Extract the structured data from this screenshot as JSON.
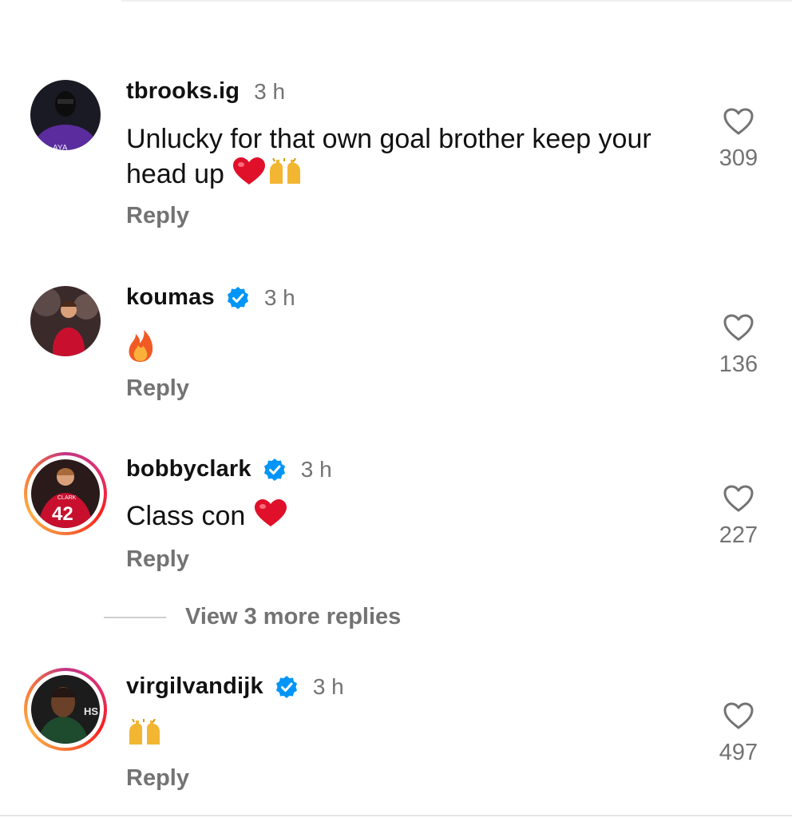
{
  "comments": [
    {
      "username": "tbrooks.ig",
      "verified": false,
      "time": "3 h",
      "text": "Unlucky for that own goal brother keep your head up",
      "emojis": [
        "red-heart",
        "raising-hands"
      ],
      "likes": "309",
      "reply_label": "Reply",
      "avatar_text": "AYA"
    },
    {
      "username": "koumas",
      "verified": true,
      "time": "3 h",
      "text": "",
      "emojis": [
        "fire"
      ],
      "likes": "136",
      "reply_label": "Reply"
    },
    {
      "username": "bobbyclark",
      "verified": true,
      "time": "3 h",
      "text": "Class con",
      "emojis": [
        "red-heart"
      ],
      "likes": "227",
      "reply_label": "Reply",
      "avatar_text": "CLARK",
      "avatar_number": "42",
      "story_ring": true
    },
    {
      "username": "virgilvandijk",
      "verified": true,
      "time": "3 h",
      "text": "",
      "emojis": [
        "raising-hands"
      ],
      "likes": "497",
      "reply_label": "Reply",
      "avatar_text": "HS",
      "story_ring": true
    }
  ],
  "view_more_replies": "View 3 more replies",
  "colors": {
    "text": "#111111",
    "muted": "#737373",
    "verified": "#0095f6",
    "heart_emoji": "#e0102a"
  }
}
